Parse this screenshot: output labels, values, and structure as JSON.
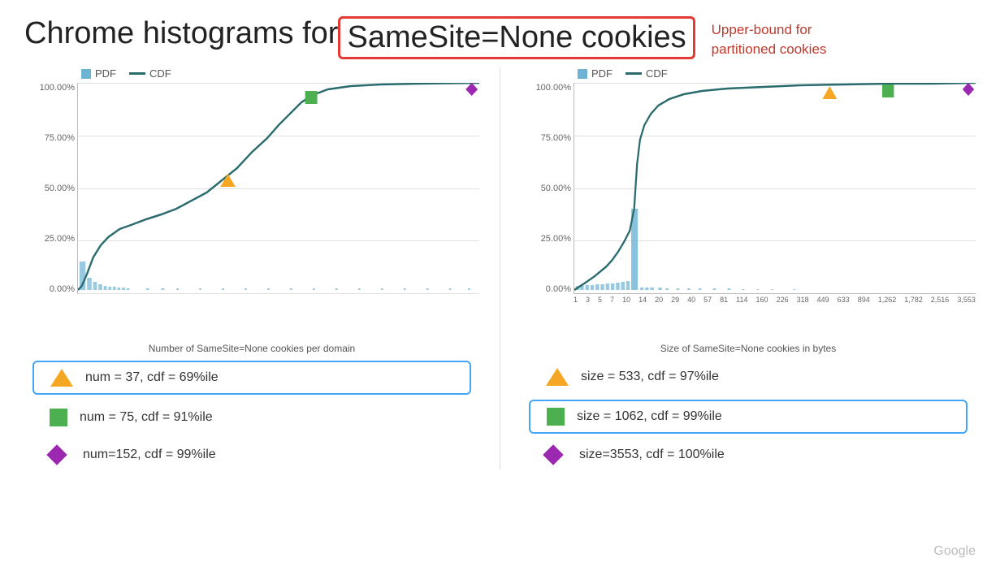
{
  "title": {
    "prefix": "Chrome histograms for ",
    "highlight": "SameSite=None cookies",
    "annotation_line1": "Upper-bound for",
    "annotation_line2": "partitioned cookies"
  },
  "chart_left": {
    "legend": {
      "pdf_label": "PDF",
      "cdf_label": "CDF"
    },
    "y_axis": [
      "100.00%",
      "75.00%",
      "50.00%",
      "25.00%",
      "0.00%"
    ],
    "subtitle": "Number of SameSite=None cookies per domain",
    "markers": [
      {
        "shape": "triangle",
        "color": "#f5a623",
        "label": "num = 37, cdf = 69%ile",
        "highlighted": true
      },
      {
        "shape": "square",
        "color": "#4caf50",
        "label": "num = 75, cdf = 91%ile",
        "highlighted": false
      },
      {
        "shape": "diamond",
        "color": "#9c27b0",
        "label": "num=152, cdf = 99%ile",
        "highlighted": false
      }
    ]
  },
  "chart_right": {
    "legend": {
      "pdf_label": "PDF",
      "cdf_label": "CDF"
    },
    "y_axis": [
      "100.00%",
      "75.00%",
      "50.00%",
      "25.00%",
      "0.00%"
    ],
    "x_labels": [
      "1",
      "3",
      "5",
      "7",
      "10",
      "14",
      "20",
      "29",
      "40",
      "57",
      "81",
      "114",
      "160",
      "226",
      "318",
      "449",
      "633",
      "894",
      "1,262",
      "1,782",
      "2,516",
      "3,553"
    ],
    "subtitle": "Size of SameSite=None cookies in bytes",
    "markers": [
      {
        "shape": "triangle",
        "color": "#f5a623",
        "label": "size = 533, cdf = 97%ile",
        "highlighted": false
      },
      {
        "shape": "square",
        "color": "#4caf50",
        "label": "size = 1062, cdf = 99%ile",
        "highlighted": true
      },
      {
        "shape": "diamond",
        "color": "#9c27b0",
        "label": "size=3553, cdf = 100%ile",
        "highlighted": false
      }
    ]
  },
  "google_watermark": "Google"
}
